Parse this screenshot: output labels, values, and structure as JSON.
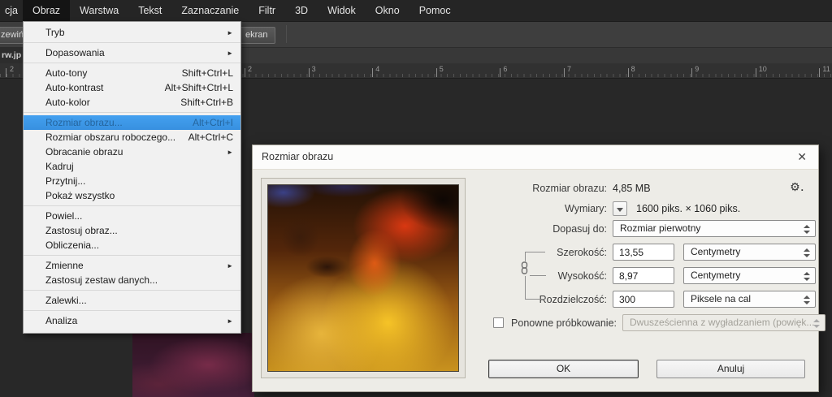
{
  "menubar": {
    "items": [
      {
        "label": "cja"
      },
      {
        "label": "Obraz",
        "active": true
      },
      {
        "label": "Warstwa"
      },
      {
        "label": "Tekst"
      },
      {
        "label": "Zaznaczanie"
      },
      {
        "label": "Filtr"
      },
      {
        "label": "3D"
      },
      {
        "label": "Widok"
      },
      {
        "label": "Okno"
      },
      {
        "label": "Pomoc"
      }
    ]
  },
  "options_bar": {
    "partial_button": "zewiń",
    "screen_button": "ekran"
  },
  "document_tab": {
    "label": "rw.jp"
  },
  "ruler": {
    "left_number": "2",
    "numbers": [
      "2",
      "3",
      "4",
      "5",
      "6",
      "7",
      "8",
      "9",
      "10",
      "11"
    ]
  },
  "menu": {
    "items": [
      {
        "label": "Tryb",
        "submenu": true
      },
      {
        "sep": true
      },
      {
        "label": "Dopasowania",
        "submenu": true
      },
      {
        "sep": true
      },
      {
        "label": "Auto-tony",
        "shortcut": "Shift+Ctrl+L"
      },
      {
        "label": "Auto-kontrast",
        "shortcut": "Alt+Shift+Ctrl+L"
      },
      {
        "label": "Auto-kolor",
        "shortcut": "Shift+Ctrl+B"
      },
      {
        "sep": true
      },
      {
        "label": "Rozmiar obrazu...",
        "shortcut": "Alt+Ctrl+I",
        "hl": true
      },
      {
        "label": "Rozmiar obszaru roboczego...",
        "shortcut": "Alt+Ctrl+C"
      },
      {
        "label": "Obracanie obrazu",
        "submenu": true
      },
      {
        "label": "Kadruj"
      },
      {
        "label": "Przytnij..."
      },
      {
        "label": "Pokaż wszystko"
      },
      {
        "sep": true
      },
      {
        "label": "Powiel..."
      },
      {
        "label": "Zastosuj obraz..."
      },
      {
        "label": "Obliczenia..."
      },
      {
        "sep": true
      },
      {
        "label": "Zmienne",
        "submenu": true
      },
      {
        "label": "Zastosuj zestaw danych..."
      },
      {
        "sep": true
      },
      {
        "label": "Zalewki..."
      },
      {
        "sep": true
      },
      {
        "label": "Analiza",
        "submenu": true
      }
    ]
  },
  "dialog": {
    "title": "Rozmiar obrazu",
    "size_row": {
      "label": "Rozmiar obrazu:",
      "value": "4,85 MB"
    },
    "dimensions_row": {
      "label": "Wymiary:",
      "value": "1600 piks.  ×  1060 piks."
    },
    "fields": {
      "fit": {
        "label": "Dopasuj do:",
        "value": "Rozmiar pierwotny"
      },
      "width": {
        "label": "Szerokość:",
        "value": "13,55",
        "unit": "Centymetry"
      },
      "height": {
        "label": "Wysokość:",
        "value": "8,97",
        "unit": "Centymetry"
      },
      "resolution": {
        "label": "Rozdzielczość:",
        "value": "300",
        "unit": "Piksele na cal"
      },
      "resample": {
        "label": "Ponowne próbkowanie:",
        "value": "Dwusześcienna z wygładzaniem (powięk...",
        "checked": false
      }
    },
    "buttons": {
      "ok": "OK",
      "cancel": "Anuluj"
    }
  },
  "icons": {
    "close": "✕",
    "gear": "⚙",
    "gear_dot": ".",
    "submenu_arrow": "►"
  },
  "colors": {
    "highlight_blue": "#3d99ec",
    "canvas_gray": "#282828",
    "menubar_dark": "#252525"
  }
}
